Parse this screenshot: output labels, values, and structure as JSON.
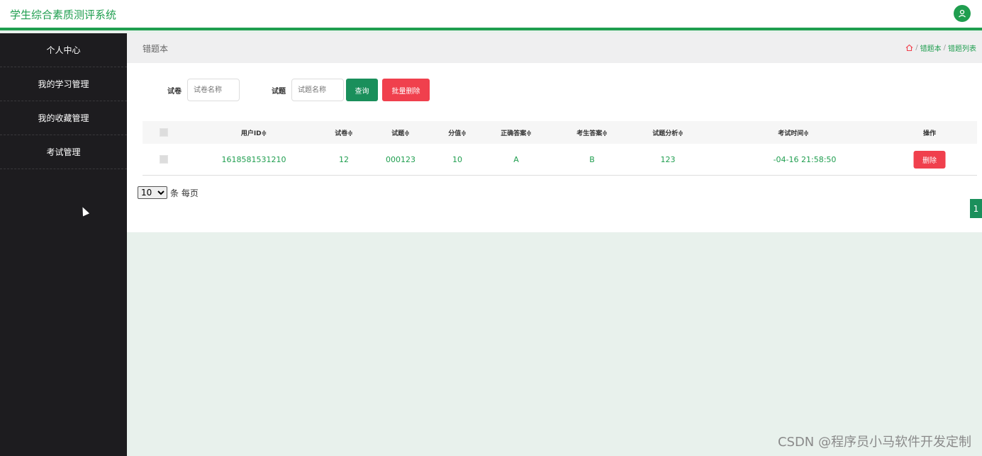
{
  "header": {
    "app_title": "学生综合素质测评系统"
  },
  "sidebar": {
    "items": [
      {
        "label": "个人中心"
      },
      {
        "label": "我的学习管理"
      },
      {
        "label": "我的收藏管理"
      },
      {
        "label": "考试管理"
      }
    ]
  },
  "main": {
    "page_title": "错题本",
    "breadcrumb": [
      "错题本",
      "错题列表"
    ],
    "search": {
      "paper_label": "试卷",
      "paper_placeholder": "试卷名称",
      "question_label": "试题",
      "question_placeholder": "试题名称",
      "query_button": "查询",
      "batch_delete_button": "批量删除"
    },
    "table": {
      "columns": [
        "用户ID≑",
        "试卷≑",
        "试题≑",
        "分值≑",
        "正确答案≑",
        "考生答案≑",
        "试题分析≑",
        "考试时间≑",
        "操作"
      ],
      "rows": [
        {
          "user_id": "1618581531210",
          "paper": "12",
          "question": "000123",
          "score": "10",
          "correct_answer": "A",
          "student_answer": "B",
          "analysis": "123",
          "exam_time": "-04-16 21:58:50",
          "action": "删除"
        }
      ]
    },
    "pagination": {
      "page_size": "10",
      "page_size_suffix": "条 每页",
      "current_page": "1"
    }
  },
  "watermark": "CSDN @程序员小马软件开发定制",
  "colors": {
    "accent": "#1f9e4f",
    "sidebar_bg": "#1d1c1f",
    "danger": "#f0404d"
  }
}
